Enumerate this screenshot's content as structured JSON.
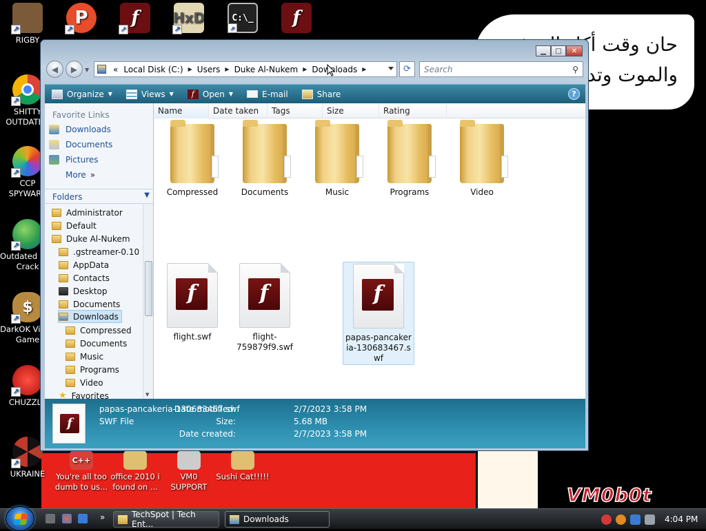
{
  "desktop": {
    "icons": [
      {
        "label": "RIGBY",
        "color": "#7b5a3a"
      },
      {
        "label": "",
        "color": "#e74c2b"
      },
      {
        "label": "",
        "color": "#6b0f12"
      },
      {
        "label": "",
        "color": "#c9b98a"
      },
      {
        "label": "",
        "color": "#222222"
      },
      {
        "label": "",
        "color": "#6b0f12"
      },
      {
        "label": "SHITTY OUTDATED",
        "color": "#3a8fd6"
      },
      {
        "label": "CCP SPYWARE",
        "color": "#f0a020"
      },
      {
        "label": "Outdated IDM Crack",
        "color": "#2a9d4a"
      },
      {
        "label": "DarkOK Video Game",
        "color": "#b88a40"
      },
      {
        "label": "CHUZZLE",
        "color": "#d62020"
      },
      {
        "label": "UKRAINE",
        "color": "#c0392b"
      },
      {
        "label": "You're all too dumb to us...",
        "color": "#d6423a"
      },
      {
        "label": "office 2010 i found on ...",
        "color": "#e0c070"
      },
      {
        "label": "VM0 SUPPORT",
        "color": "#cccccc"
      },
      {
        "label": "Sushi Cat!!!!!",
        "color": "#e0c070"
      }
    ],
    "bubble_lines": [
      "حان وقت أكل القرف",
      "والموت وتدمير"
    ],
    "watermark": "VM0b0t"
  },
  "window": {
    "address": {
      "crumbs": [
        "Local Disk (C:)",
        "Users",
        "Duke Al-Nukem",
        "Downloads"
      ],
      "prefix": "«"
    },
    "search_placeholder": "Search",
    "toolbar": {
      "organize": "Organize",
      "views": "Views",
      "open": "Open",
      "email": "E-mail",
      "share": "Share",
      "help": "?"
    },
    "favorites": {
      "title": "Favorite Links",
      "items": [
        "Downloads",
        "Documents",
        "Pictures",
        "More"
      ]
    },
    "folders_header": "Folders",
    "tree": [
      {
        "label": "Administrator",
        "level": 0
      },
      {
        "label": "Default",
        "level": 0
      },
      {
        "label": "Duke Al-Nukem",
        "level": 0
      },
      {
        "label": ".gstreamer-0.10",
        "level": 1
      },
      {
        "label": "AppData",
        "level": 1
      },
      {
        "label": "Contacts",
        "level": 1
      },
      {
        "label": "Desktop",
        "level": 1
      },
      {
        "label": "Documents",
        "level": 1
      },
      {
        "label": "Downloads",
        "level": 1,
        "selected": true
      },
      {
        "label": "Compressed",
        "level": 2
      },
      {
        "label": "Documents",
        "level": 2
      },
      {
        "label": "Music",
        "level": 2
      },
      {
        "label": "Programs",
        "level": 2
      },
      {
        "label": "Video",
        "level": 2
      },
      {
        "label": "Favorites",
        "level": 1
      }
    ],
    "columns": [
      "Name",
      "Date taken",
      "Tags",
      "Size",
      "Rating"
    ],
    "folders": [
      "Compressed",
      "Documents",
      "Music",
      "Programs",
      "Video"
    ],
    "files": [
      {
        "name": "flight.swf"
      },
      {
        "name": "flight-759879f9.swf"
      },
      {
        "name": "papas-pancakeria-130683467.swf",
        "selected": true
      }
    ],
    "details": {
      "name": "papas-pancakeria-130683467.swf",
      "type": "SWF File",
      "modified_label": "Date modified:",
      "modified": "2/7/2023 3:58 PM",
      "size_label": "Size:",
      "size": "5.68 MB",
      "created_label": "Date created:",
      "created": "2/7/2023 3:58 PM"
    }
  },
  "taskbar": {
    "buttons": [
      "TechSpot | Tech Ent...",
      "Downloads"
    ],
    "clock": "4:04 PM",
    "chevron": "»"
  }
}
